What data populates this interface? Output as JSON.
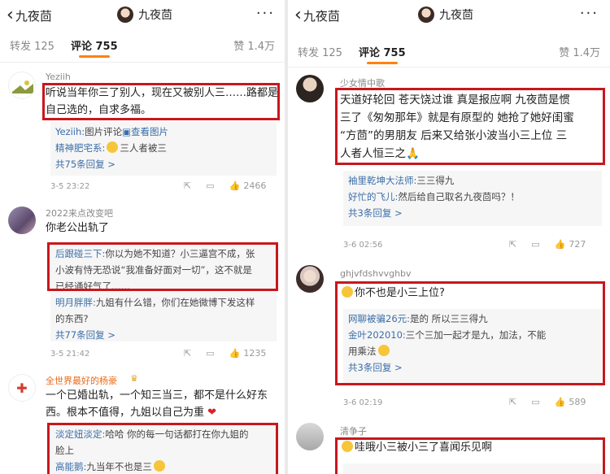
{
  "left": {
    "nav": {
      "back_label": "九夜茴",
      "title": "九夜茴",
      "more": "···"
    },
    "tabs": {
      "repost": "转发 125",
      "comment": "评论 755",
      "like": "赞 1.4万"
    },
    "comments": [
      {
        "user": "Yeziih",
        "text1": "听说当年你三了别人，现在又被别人三……路都是",
        "text2": "自己选的，自求多福。",
        "reply_user1": "Yeziih:",
        "reply_text1": "图片评论",
        "reply_link1": "查看图片",
        "reply_user2": "精神肥宅系:",
        "reply_text2": "三人者被三",
        "reply_more": "共75条回复 >",
        "time": "3-5 23:22",
        "likes": "2466"
      },
      {
        "user": "2022来点改变吧",
        "text1": "你老公出轨了",
        "reply_user1": "后跟碰三下:",
        "reply_text1a": "你以为她不知道？小三逼宫不成，张",
        "reply_text1b": "小波有恃无恐说“我准备好面对一切”，这不就是",
        "reply_text1c": "已经通好气了……",
        "reply_user2": "明月胖胖:",
        "reply_text2a": "九姐有什么错，你们在她微博下发这样",
        "reply_text2b": "的东西?",
        "reply_more": "共77条回复 >",
        "time": "3-5 21:42",
        "likes": "1235"
      },
      {
        "user": "全世界最好的杨豪",
        "text1": "一个已婚出轨，一个知三当三，都不是什么好东",
        "text2": "西。根本不值得，九姐以自己为重",
        "reply_user1": "淡定妞淡定:",
        "reply_text1a": "哈哈 你的每一句话都打在你九姐的",
        "reply_text1b": "脸上",
        "reply_user2": "高能鹅:",
        "reply_text2": "九当年不也是三"
      }
    ]
  },
  "right": {
    "nav": {
      "back_label": "九夜茴",
      "title": "九夜茴",
      "more": "···"
    },
    "tabs": {
      "repost": "转发 125",
      "comment": "评论 755",
      "like": "赞 1.4万"
    },
    "comments": [
      {
        "user": "少女情中歌",
        "text1": "天道好轮回 苍天饶过谁 真是报应啊 九夜茴是惯",
        "text2": "三了《匆匆那年》就是有原型的 她抢了她好闺蜜",
        "text3": "“方茴”的男朋友 后来又给张小波当小三上位 三",
        "text4": "人者人恒三之",
        "reply_user1": "袖里乾坤大法师:",
        "reply_text1": "三三得九",
        "reply_user2": "好忙的飞儿:",
        "reply_text2": "然后给自己取名九夜茴吗？！",
        "reply_more": "共3条回复 >",
        "time": "3-6 02:56",
        "likes": "727"
      },
      {
        "user": "ghjvfdshvvghbv",
        "text1": "你不也是小三上位?",
        "reply_user1": "网聊被骗26元:",
        "reply_text1": "是的 所以三三得九",
        "reply_user2": "金叶202010:",
        "reply_text2a": "三个三加一起才是九，加法，不能",
        "reply_text2b": "用乘法",
        "reply_more": "共3条回复 >",
        "time": "3-6 02:19",
        "likes": "589"
      },
      {
        "user": "清争子",
        "text1": "哇哦小三被小三了喜闻乐见啊"
      }
    ]
  }
}
